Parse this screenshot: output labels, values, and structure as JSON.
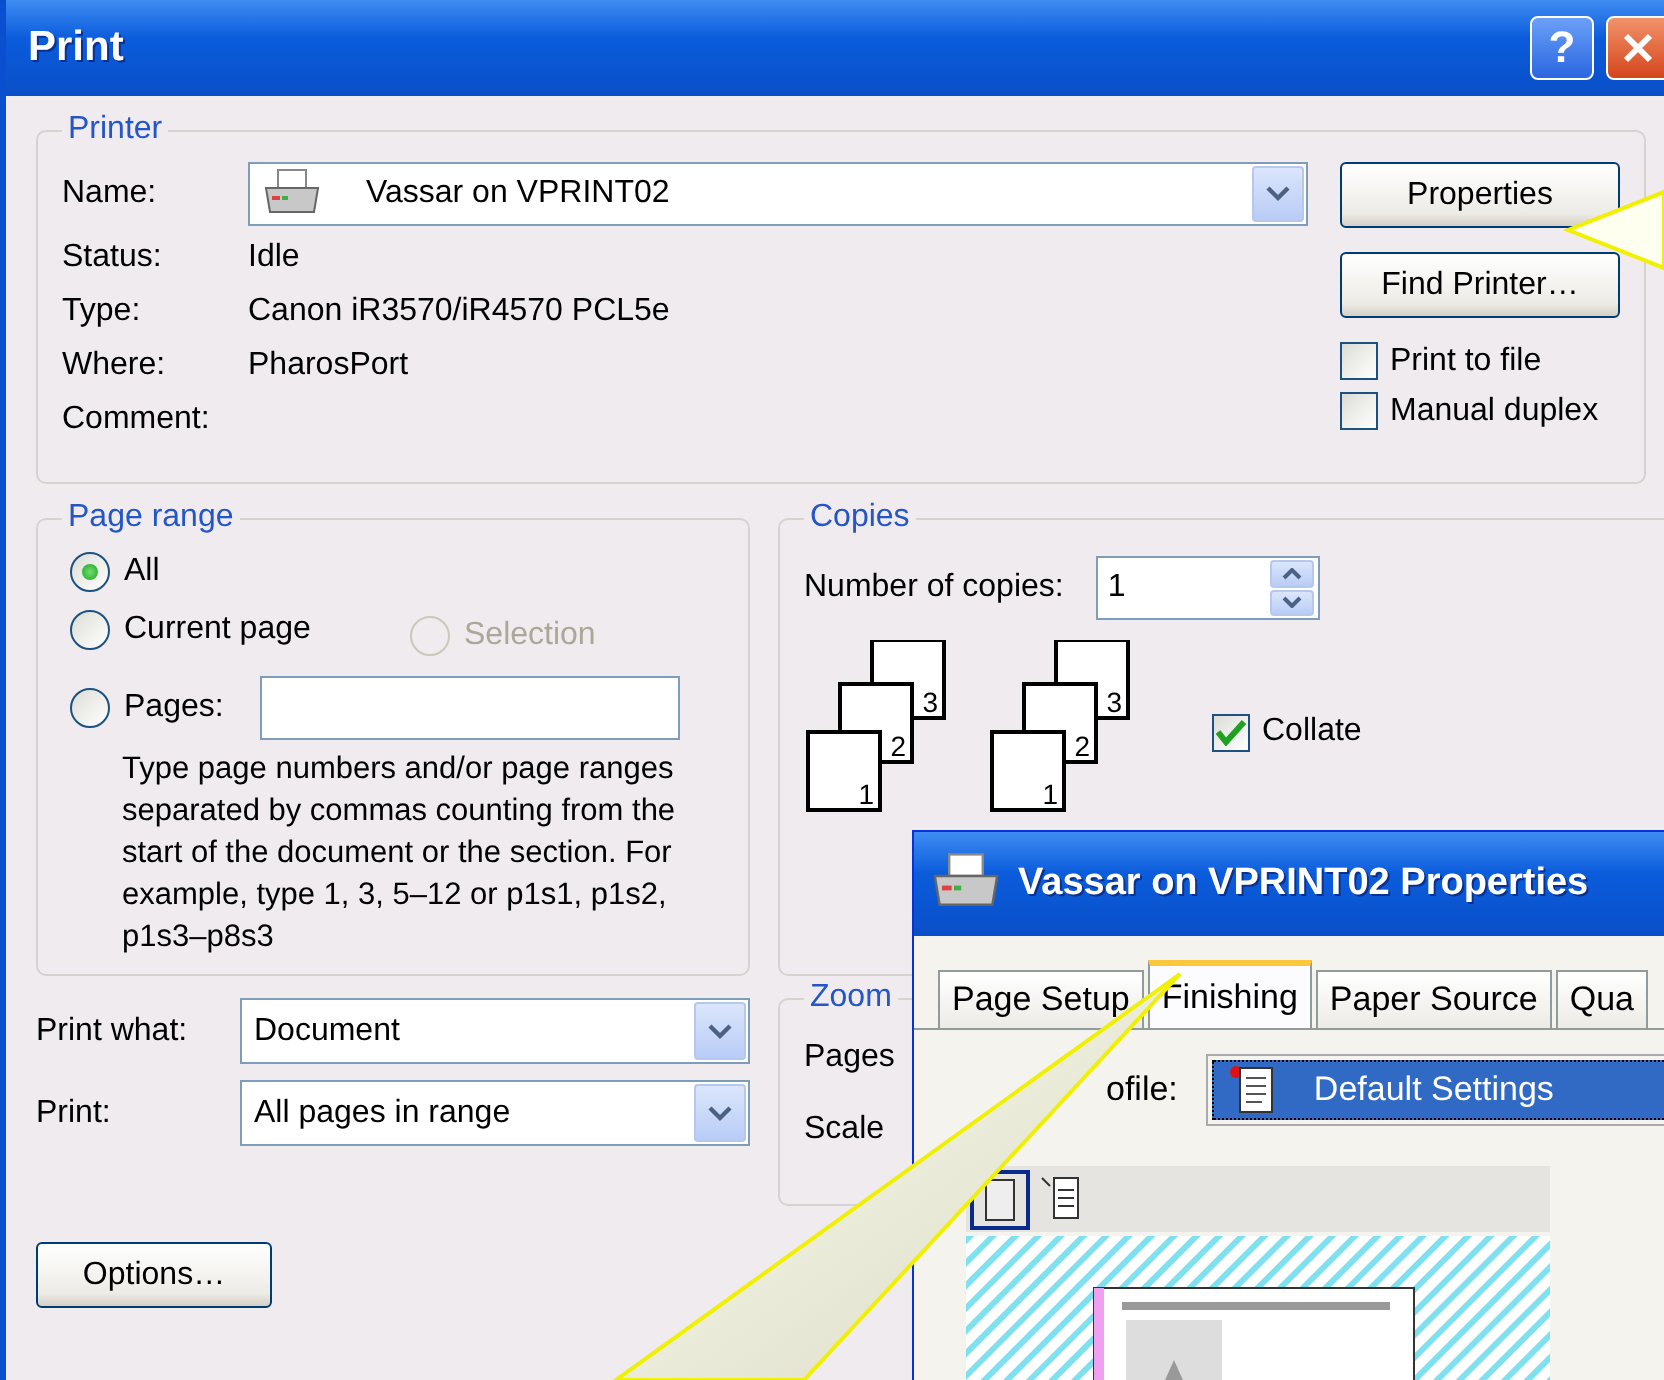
{
  "window": {
    "title": "Print",
    "help_button": "?"
  },
  "printer": {
    "legend": "Printer",
    "fields": [
      {
        "label": "Name:",
        "value": "Vassar on VPRINT02",
        "kind": "dropdown"
      },
      {
        "label": "Status:",
        "value": "Idle",
        "kind": "text"
      },
      {
        "label": "Type:",
        "value": "Canon iR3570/iR4570 PCL5e",
        "kind": "text"
      },
      {
        "label": "Where:",
        "value": "PharosPort",
        "kind": "text"
      },
      {
        "label": "Comment:",
        "kind": "text"
      }
    ],
    "buttons": [
      "Properties",
      "Find Printer…"
    ],
    "checkboxes": [
      {
        "label": "Print to file",
        "checked": false
      },
      {
        "label": "Manual duplex",
        "checked": false
      }
    ]
  },
  "page_range": {
    "legend": "Page range",
    "options": [
      {
        "label": "All",
        "selected": true,
        "disabled": false
      },
      {
        "label": "Current page",
        "selected": false,
        "disabled": false
      },
      {
        "label": "Selection",
        "selected": false,
        "disabled": true
      },
      {
        "label": "Pages:",
        "selected": false,
        "disabled": false
      }
    ],
    "hint": "Type page numbers and/or page ranges separated by commas counting from the start of the document or the section. For example, type 1, 3, 5–12 or p1s1, p1s2, p1s3–p8s3"
  },
  "copies": {
    "legend": "Copies",
    "label": "Number of copies:",
    "value": "1",
    "stacks": [
      [
        "1",
        "2",
        "3"
      ],
      [
        "1",
        "2",
        "3"
      ]
    ],
    "collate": {
      "label": "Collate",
      "checked": true
    }
  },
  "print_what": {
    "label": "Print what:",
    "value": "Document"
  },
  "print": {
    "label": "Print:",
    "value": "All pages in range"
  },
  "zoom": {
    "legend": "Zoom",
    "labels": [
      "Pages",
      "Scale"
    ]
  },
  "options_button": "Options…",
  "properties_window": {
    "title": "Vassar on VPRINT02 Properties",
    "tabs": [
      {
        "label": "Page Setup",
        "selected": false
      },
      {
        "label": "Finishing",
        "selected": true
      },
      {
        "label": "Paper Source",
        "selected": false
      },
      {
        "label": "Qua",
        "selected": false
      }
    ],
    "profile_label": "ofile:",
    "profile_value": "Default Settings"
  }
}
